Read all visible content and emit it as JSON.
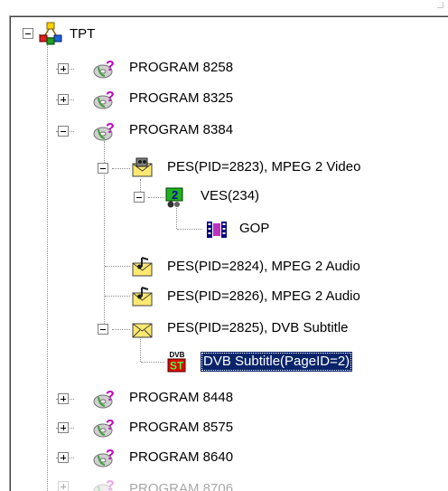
{
  "tree": {
    "root": {
      "label": "TPT",
      "icon": "network-tree-icon",
      "expanded": true
    },
    "nodes": [
      {
        "id": "program-8258",
        "label": "PROGRAM 8258",
        "icon": "program-disc-icon",
        "expanded": false
      },
      {
        "id": "program-8325",
        "label": "PROGRAM 8325",
        "icon": "program-disc-icon",
        "expanded": false
      },
      {
        "id": "program-8384",
        "label": "PROGRAM 8384",
        "icon": "program-disc-icon",
        "expanded": true,
        "children": [
          {
            "id": "pes-2823",
            "label": "PES(PID=2823), MPEG 2 Video",
            "icon": "pes-video-envelope-icon",
            "expanded": true,
            "children": [
              {
                "id": "ves-234",
                "label": "VES(234)",
                "icon": "ves-green-icon",
                "expanded": true,
                "children": [
                  {
                    "id": "gop",
                    "label": "GOP",
                    "icon": "film-strip-icon"
                  }
                ]
              }
            ]
          },
          {
            "id": "pes-2824",
            "label": "PES(PID=2824), MPEG 2 Audio",
            "icon": "pes-audio-envelope-icon"
          },
          {
            "id": "pes-2826",
            "label": "PES(PID=2826), MPEG 2 Audio",
            "icon": "pes-audio-envelope-icon"
          },
          {
            "id": "pes-2825",
            "label": "PES(PID=2825), DVB Subtitle",
            "icon": "pes-subtitle-envelope-icon",
            "expanded": true,
            "children": [
              {
                "id": "dvb-subtitle",
                "label": "DVB Subtitle(PageID=2)",
                "icon": "dvb-st-icon",
                "icon_text_top": "DVB",
                "icon_text_bottom": "ST",
                "selected": true
              }
            ]
          }
        ]
      },
      {
        "id": "program-8448",
        "label": "PROGRAM 8448",
        "icon": "program-disc-icon",
        "expanded": false
      },
      {
        "id": "program-8575",
        "label": "PROGRAM 8575",
        "icon": "program-disc-icon",
        "expanded": false
      },
      {
        "id": "program-8640",
        "label": "PROGRAM 8640",
        "icon": "program-disc-icon",
        "expanded": false
      },
      {
        "id": "program-8706",
        "label": "PROGRAM 8706",
        "icon": "program-disc-icon",
        "expanded": false,
        "partially_visible": true
      }
    ]
  },
  "colors": {
    "selection_bg": "#0a246a",
    "selection_text": "#ffffff",
    "disc_ring": "#a0a0a0",
    "question_mark": "#c000c0",
    "envelope": "#ffe870",
    "ves_green": "#20b020",
    "dvb_red": "#e00000"
  }
}
